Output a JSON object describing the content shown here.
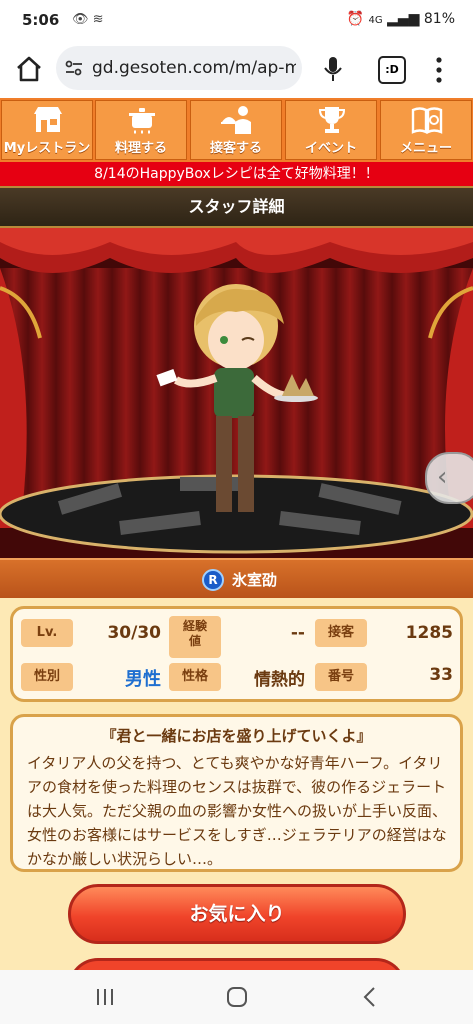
{
  "status": {
    "time": "5:06",
    "battery": "81%",
    "network": "4G"
  },
  "browser": {
    "url": "gd.gesoten.com/m/ap-m",
    "tabs_label": ":D"
  },
  "game_nav": {
    "items": [
      {
        "label": "Myレストラン",
        "icon": "restaurant-icon"
      },
      {
        "label": "料理する",
        "icon": "cooking-pot-icon"
      },
      {
        "label": "接客する",
        "icon": "waiter-icon"
      },
      {
        "label": "イベント",
        "icon": "trophy-icon"
      },
      {
        "label": "メニュー",
        "icon": "menu-book-icon"
      }
    ]
  },
  "banner": "8/14のHappyBoxレシピは全て好物料理！！",
  "page_title": "スタッフ詳細",
  "staff": {
    "rarity": "R",
    "name": "氷室劭",
    "stats": {
      "lv_label": "Lv.",
      "lv_value": "30/30",
      "exp_label_1": "経験",
      "exp_label_2": "値",
      "exp_value": "--",
      "service_label": "接客",
      "service_value": "1285",
      "gender_label": "性別",
      "gender_value": "男性",
      "personality_label": "性格",
      "personality_value": "情熱的",
      "number_label": "番号",
      "number_value": "33"
    },
    "quote": "『君と一緒にお店を盛り上げていくよ』",
    "description": "イタリア人の父を持つ、とても爽やかな好青年ハーフ。イタリアの食材を使った料理のセンスは抜群で、彼の作るジェラートは大人気。ただ父親の血の影響か女性への扱いが上手い反面、女性のお客様にはサービスをしすぎ…ジェラテリアの経営はなかなか厳しい状況らしい…。"
  },
  "buttons": {
    "favorite": "お気に入り"
  },
  "colors": {
    "nav_orange": "#f69a44",
    "banner_red": "#e60012",
    "button_red": "#f0442a",
    "content_bg": "#fde9b5"
  }
}
